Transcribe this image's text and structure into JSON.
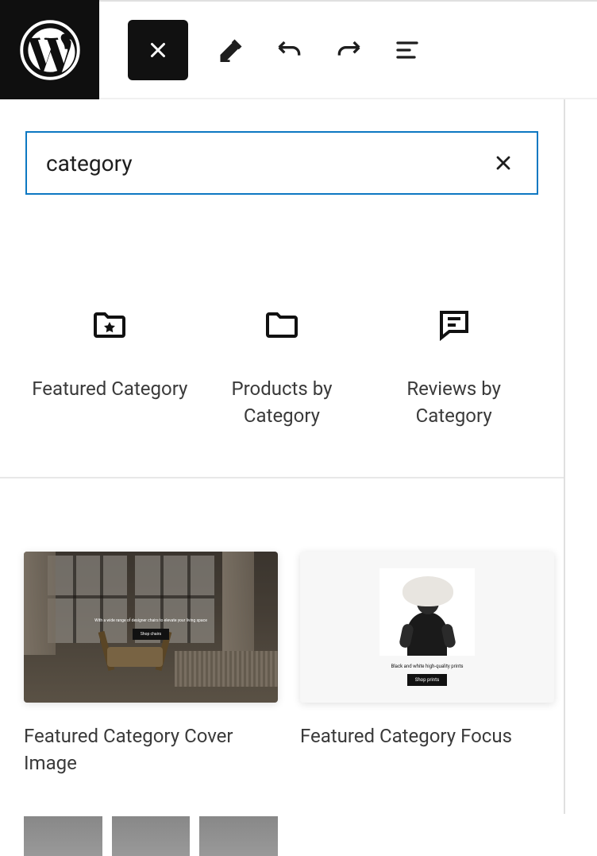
{
  "search": {
    "value": "category"
  },
  "blocks": [
    {
      "label": "Featured Category",
      "icon": "folder-star"
    },
    {
      "label": "Products by Category",
      "icon": "folder"
    },
    {
      "label": "Reviews by Category",
      "icon": "chat-lines"
    }
  ],
  "patterns": [
    {
      "label": "Featured Category Cover Image",
      "preview": {
        "tagline": "With a wide range of designer chairs to elevate your living space",
        "button": "Shop chairs"
      }
    },
    {
      "label": "Featured Category Focus",
      "preview": {
        "tagline": "Black and white high-quality prints",
        "button": "Shop prints"
      }
    }
  ]
}
